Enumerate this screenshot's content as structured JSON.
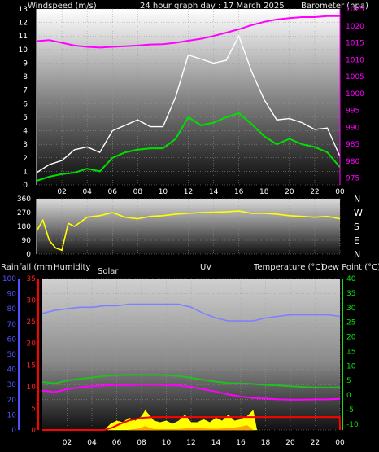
{
  "colors": {
    "wind_avg": "#00e000",
    "wind_gust": "#ffffff",
    "barometer": "#ff00ff",
    "direction": "#ffff00",
    "humidity": "#8080ff",
    "rainfall": "#ff0000",
    "solar": "#ffff00",
    "uv": "#ff9900",
    "temperature": "#20c020",
    "dew_point": "#ff00ff"
  },
  "wind_panel": {
    "title": "24 hour graph day : 17 March 2025",
    "left_label": "Windspeed (m/s)",
    "right_label": "Barometer (hpa)"
  },
  "direction_panel": {
    "compass": [
      "N",
      "W",
      "S",
      "E",
      "N"
    ]
  },
  "env_panel": {
    "labels": {
      "rainfall": "Rainfall (mm)",
      "humidity": "Humidity",
      "solar": "Solar",
      "uv": "UV",
      "temperature": "Temperature (°C)",
      "dew_point": "Dew Point (°C)"
    }
  },
  "chart_data": [
    {
      "type": "line",
      "name": "wind_barometer",
      "x_ticks": [
        "02",
        "04",
        "06",
        "08",
        "10",
        "12",
        "14",
        "16",
        "18",
        "20",
        "22",
        "00"
      ],
      "xlim": [
        0,
        24
      ],
      "ylim": [
        0,
        13
      ],
      "y_ticks": [
        0,
        1,
        2,
        3,
        4,
        5,
        6,
        7,
        8,
        9,
        10,
        11,
        12,
        13
      ],
      "y2lim": [
        973,
        1025
      ],
      "y2_ticks": [
        975,
        980,
        985,
        990,
        995,
        1000,
        1005,
        1010,
        1015,
        1020,
        1025
      ],
      "series": [
        {
          "name": "Barometer (hpa)",
          "axis": "right",
          "x": [
            0,
            1,
            2,
            3,
            4,
            5,
            6,
            7,
            8,
            9,
            10,
            11,
            12,
            13,
            14,
            15,
            16,
            17,
            18,
            19,
            20,
            21,
            22,
            23,
            24
          ],
          "values": [
            1015.5,
            1015.8,
            1015,
            1014.2,
            1013.8,
            1013.6,
            1013.8,
            1014,
            1014.2,
            1014.5,
            1014.6,
            1015,
            1015.6,
            1016.2,
            1017,
            1018,
            1019,
            1020.2,
            1021.2,
            1021.9,
            1022.3,
            1022.6,
            1022.6,
            1022.9,
            1022.9
          ]
        },
        {
          "name": "Windspeed (m/s)",
          "axis": "left",
          "x": [
            0,
            1,
            2,
            3,
            4,
            5,
            6,
            7,
            8,
            9,
            10,
            11,
            12,
            13,
            14,
            15,
            16,
            17,
            18,
            19,
            20,
            21,
            22,
            23,
            24
          ],
          "values": [
            0.3,
            0.6,
            0.8,
            0.9,
            1.2,
            1.0,
            2.0,
            2.4,
            2.6,
            2.7,
            2.7,
            3.4,
            5.0,
            4.4,
            4.6,
            5.0,
            5.3,
            4.5,
            3.6,
            3.0,
            3.4,
            3.0,
            2.8,
            2.4,
            1.3
          ]
        },
        {
          "name": "Gust (m/s)",
          "axis": "left",
          "x": [
            0,
            1,
            2,
            3,
            4,
            5,
            6,
            7,
            8,
            9,
            10,
            11,
            12,
            13,
            14,
            15,
            16,
            17,
            18,
            19,
            20,
            21,
            22,
            23,
            24
          ],
          "values": [
            0.9,
            1.5,
            1.8,
            2.6,
            2.8,
            2.4,
            4.0,
            4.4,
            4.8,
            4.3,
            4.3,
            6.5,
            9.6,
            9.3,
            9.0,
            9.2,
            11.0,
            8.4,
            6.3,
            4.8,
            4.9,
            4.6,
            4.1,
            4.2,
            2.1
          ]
        }
      ]
    },
    {
      "type": "line",
      "name": "wind_direction",
      "x_ticks": [
        "02",
        "04",
        "06",
        "08",
        "10",
        "12",
        "14",
        "16",
        "18",
        "20",
        "22",
        "00"
      ],
      "xlim": [
        0,
        24
      ],
      "ylim": [
        0,
        360
      ],
      "y_ticks": [
        0,
        90,
        180,
        270,
        360
      ],
      "series": [
        {
          "name": "Direction",
          "x": [
            0,
            0.5,
            1,
            1.5,
            2,
            2.5,
            3,
            3.5,
            4,
            5,
            6,
            7,
            8,
            9,
            10,
            11,
            12,
            13,
            14,
            15,
            16,
            17,
            18,
            19,
            20,
            21,
            22,
            23,
            24
          ],
          "values": [
            150,
            220,
            90,
            40,
            25,
            200,
            180,
            210,
            240,
            250,
            270,
            240,
            230,
            245,
            250,
            260,
            265,
            270,
            272,
            275,
            280,
            265,
            265,
            260,
            250,
            245,
            240,
            245,
            230
          ]
        }
      ]
    },
    {
      "type": "line",
      "name": "environment",
      "x_ticks": [
        "02",
        "04",
        "06",
        "08",
        "10",
        "12",
        "14",
        "16",
        "18",
        "20",
        "22",
        "00"
      ],
      "xlim": [
        0,
        24
      ],
      "axes": {
        "humidity": {
          "ylim": [
            0,
            100
          ],
          "ticks": [
            0,
            10,
            20,
            30,
            40,
            50,
            60,
            70,
            80,
            90,
            100
          ]
        },
        "rainfall": {
          "ylim": [
            0,
            35
          ],
          "ticks": [
            0,
            5,
            10,
            15,
            20,
            25,
            30,
            35
          ]
        },
        "temperature": {
          "ylim": [
            -12,
            40
          ],
          "ticks": [
            -10,
            -5,
            0,
            5,
            10,
            15,
            20,
            25,
            30,
            35,
            40
          ]
        }
      },
      "series": [
        {
          "name": "Humidity",
          "x": [
            0,
            1,
            2,
            3,
            4,
            5,
            6,
            7,
            8,
            9,
            10,
            11,
            12,
            13,
            14,
            15,
            16,
            17,
            18,
            19,
            20,
            21,
            22,
            23,
            24
          ],
          "values": [
            77,
            79,
            80,
            81,
            81,
            82,
            82,
            83,
            83,
            83,
            83,
            83,
            81,
            77,
            74,
            72,
            72,
            72,
            74,
            75,
            76,
            76,
            76,
            76,
            75
          ]
        },
        {
          "name": "Temperature (°C)",
          "x": [
            0,
            1,
            2,
            3,
            4,
            5,
            6,
            7,
            8,
            9,
            10,
            11,
            12,
            13,
            14,
            15,
            16,
            17,
            18,
            19,
            20,
            21,
            22,
            23,
            24
          ],
          "values": [
            4.5,
            4.0,
            5.0,
            5.5,
            6.0,
            6.5,
            6.8,
            6.9,
            6.9,
            6.9,
            6.8,
            6.5,
            5.9,
            5.2,
            4.6,
            4.1,
            4.0,
            3.8,
            3.5,
            3.3,
            3.0,
            2.8,
            2.6,
            2.6,
            2.6
          ]
        },
        {
          "name": "Dew Point (°C)",
          "x": [
            0,
            1,
            2,
            3,
            4,
            5,
            6,
            7,
            8,
            9,
            10,
            11,
            12,
            13,
            14,
            15,
            16,
            17,
            18,
            19,
            20,
            21,
            22,
            23,
            24
          ],
          "values": [
            1.5,
            1.0,
            2.0,
            2.6,
            3.0,
            3.3,
            3.5,
            3.5,
            3.6,
            3.6,
            3.5,
            3.3,
            2.8,
            2.0,
            1.2,
            0.2,
            -0.5,
            -1.0,
            -1.2,
            -1.5,
            -1.6,
            -1.6,
            -1.5,
            -1.5,
            -1.3
          ]
        },
        {
          "name": "Rainfall (mm)",
          "x": [
            0,
            1,
            2,
            3,
            4,
            5,
            5.6,
            6.2,
            7,
            8,
            9,
            10,
            11,
            12,
            13,
            14,
            15,
            16,
            17,
            18,
            19,
            20,
            21,
            22,
            23,
            23.98,
            24
          ],
          "values": [
            0,
            0,
            0,
            0,
            0,
            0,
            0.5,
            1.3,
            2.2,
            2.8,
            3.0,
            3.0,
            3.0,
            3.0,
            3.0,
            3.0,
            3.0,
            3.0,
            3.0,
            3.0,
            3.0,
            3.0,
            3.0,
            3.0,
            3.0,
            3.0,
            0
          ]
        },
        {
          "name": "Solar",
          "x": [
            5,
            5.5,
            6,
            6.5,
            7,
            7.5,
            8,
            8.3,
            8.6,
            9,
            9.5,
            10,
            10.5,
            11,
            11.5,
            12,
            12.5,
            13,
            13.5,
            14,
            14.5,
            15,
            15.5,
            16,
            16.5,
            17,
            17.3
          ],
          "values": [
            0,
            4,
            6,
            5,
            8,
            6,
            9,
            13,
            10,
            6,
            5,
            6,
            4,
            6,
            10,
            5,
            5,
            7,
            5,
            8,
            6,
            10,
            6,
            7,
            9,
            13,
            0
          ]
        },
        {
          "name": "UV",
          "x": [
            7,
            7.8,
            8.3,
            8.6,
            9,
            10,
            11,
            12,
            13,
            14,
            15,
            16,
            16.5,
            17
          ],
          "values": [
            0,
            0.8,
            2.5,
            1.5,
            0.5,
            0.4,
            0.5,
            1.2,
            0.8,
            0.6,
            1.0,
            2.0,
            3.0,
            0
          ]
        }
      ]
    }
  ]
}
